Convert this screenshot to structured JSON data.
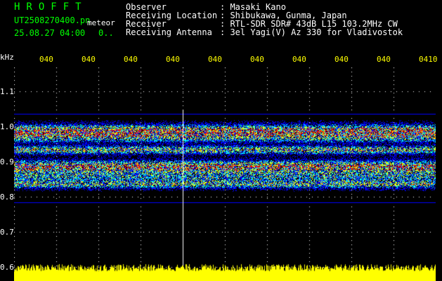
{
  "header": {
    "logo": "HROFFT",
    "filename": "UT2508270400.pn",
    "filename_suffix": "meteor",
    "timestamp": "25.08.27 04:00",
    "count": "0..",
    "fields": [
      {
        "label": "Observer",
        "value": ": Masaki Kano"
      },
      {
        "label": "Receiving Location",
        "value": ": Shibukawa, Gunma, Japan"
      },
      {
        "label": "Receiver",
        "value": ": RTL-SDR SDR# 43dB L15 103.2MHz CW"
      },
      {
        "label": "Receiving Antenna",
        "value": ": 3el Yagi(V) Az 330 for Vladivostok"
      }
    ]
  },
  "axis": {
    "unit": "kHz",
    "time_ticks": [
      "040",
      "040",
      "040",
      "040",
      "040",
      "040",
      "040",
      "040",
      "040",
      "0410"
    ],
    "freq_ticks": [
      "1.1",
      "1.0",
      "0.9",
      "0.8",
      "0.7",
      "0.6"
    ]
  },
  "colors": {
    "background": "#000000",
    "logo": "#00ff00",
    "tick_label": "#ffff00",
    "grid": "#ffffff",
    "signal_low": "#0000ff",
    "signal_mid": "#00ffff",
    "signal_high": "#ffff00",
    "signal_peak": "#ff0000",
    "level_meter": "#ffff00"
  }
}
